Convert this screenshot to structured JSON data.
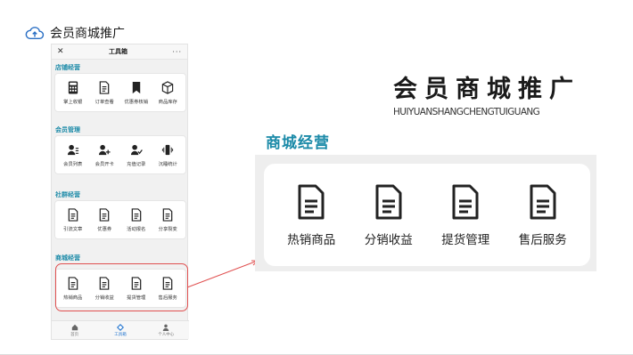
{
  "header": {
    "title": "会员商城推广",
    "icon": "cloud-upload-icon"
  },
  "phone": {
    "topbar": {
      "close": "✕",
      "title": "工具箱",
      "more": "···"
    },
    "sections": [
      {
        "title": "店铺经营",
        "items": [
          {
            "label": "掌上收银",
            "icon": "calculator-icon"
          },
          {
            "label": "订单查看",
            "icon": "document-icon"
          },
          {
            "label": "优惠券核销",
            "icon": "bookmark-icon"
          },
          {
            "label": "商品库存",
            "icon": "box-icon"
          }
        ]
      },
      {
        "title": "会员管理",
        "items": [
          {
            "label": "会员列表",
            "icon": "user-list-icon"
          },
          {
            "label": "会员开卡",
            "icon": "user-add-icon"
          },
          {
            "label": "充值记录",
            "icon": "user-check-icon"
          },
          {
            "label": "沉睡统计",
            "icon": "vibrate-icon"
          }
        ]
      },
      {
        "title": "社群经营",
        "items": [
          {
            "label": "引流文章",
            "icon": "document-icon"
          },
          {
            "label": "优惠券",
            "icon": "document-icon"
          },
          {
            "label": "活动报名",
            "icon": "document-icon"
          },
          {
            "label": "分享裂变",
            "icon": "document-icon"
          }
        ]
      },
      {
        "title": "商城经营",
        "items": [
          {
            "label": "热销商品",
            "icon": "document-icon"
          },
          {
            "label": "分销收益",
            "icon": "document-icon"
          },
          {
            "label": "提货管理",
            "icon": "document-icon"
          },
          {
            "label": "售后服务",
            "icon": "document-icon"
          }
        ]
      }
    ],
    "tabbar": [
      {
        "label": "首页",
        "icon": "home-icon",
        "active": false
      },
      {
        "label": "工具箱",
        "icon": "toolbox-icon",
        "active": true
      },
      {
        "label": "个人中心",
        "icon": "person-icon",
        "active": false
      }
    ]
  },
  "main": {
    "title": "会员商城推广",
    "subtitle": "HUIYUANSHANGCHENGTUIGUANG",
    "section_title": "商城经营",
    "items": [
      {
        "label": "热销商品",
        "icon": "document-icon"
      },
      {
        "label": "分销收益",
        "icon": "document-icon"
      },
      {
        "label": "提货管理",
        "icon": "document-icon"
      },
      {
        "label": "售后服务",
        "icon": "document-icon"
      }
    ]
  },
  "colors": {
    "accent": "#1b8aa8",
    "highlight": "#e05050",
    "tab_active": "#2a7ad1"
  }
}
